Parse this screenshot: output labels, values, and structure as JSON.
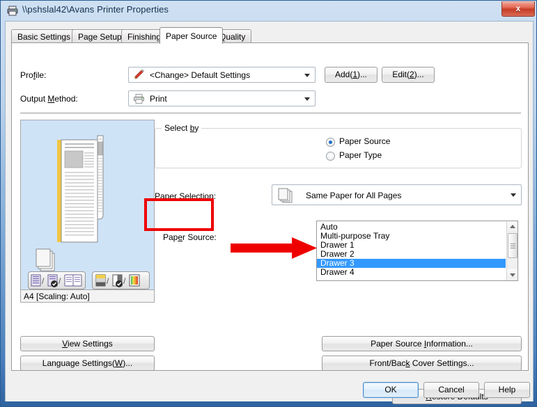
{
  "window": {
    "title": "\\\\pshslal42\\Avans Printer Properties",
    "icon": "printer-icon",
    "close_label": "x"
  },
  "tabs": [
    {
      "label": "Basic Settings",
      "active": false
    },
    {
      "label": "Page Setup",
      "active": false
    },
    {
      "label": "Finishing",
      "active": false
    },
    {
      "label": "Paper Source",
      "active": true
    },
    {
      "label": "Quality",
      "active": false
    }
  ],
  "profile_row": {
    "label": "Profile:",
    "value": "<Change> Default Settings",
    "icon": "pencil-icon",
    "add_button": "Add(1)...",
    "edit_button": "Edit(2)..."
  },
  "output_row": {
    "label": "Output Method:",
    "value": "Print",
    "icon": "printer-small-icon"
  },
  "preview": {
    "status": "A4 [Scaling: Auto]"
  },
  "select_by": {
    "title": "Select by",
    "options": [
      {
        "label": "Paper Source",
        "selected": true
      },
      {
        "label": "Paper Type",
        "selected": false
      }
    ]
  },
  "paper_selection": {
    "label": "Paper Selection:",
    "value": "Same Paper for All Pages",
    "icon": "stacked-paper-icon"
  },
  "paper_source": {
    "label": "Paper Source:",
    "items": [
      {
        "label": "Auto",
        "selected": false
      },
      {
        "label": "Multi-purpose Tray",
        "selected": false
      },
      {
        "label": "Drawer 1",
        "selected": false
      },
      {
        "label": "Drawer 2",
        "selected": false
      },
      {
        "label": "Drawer 3",
        "selected": true
      },
      {
        "label": "Drawer 4",
        "selected": false
      }
    ]
  },
  "left_buttons": {
    "view_settings": "View Settings",
    "language_settings": "Language Settings(W)..."
  },
  "right_buttons": {
    "paper_source_information": "Paper Source Information...",
    "front_back_cover_settings": "Front/Back Cover Settings...",
    "restore_defaults": "Restore Defaults"
  },
  "dialog_buttons": {
    "ok": "OK",
    "cancel": "Cancel",
    "help": "Help"
  },
  "annotations": {
    "highlight_color": "#ee0000"
  }
}
